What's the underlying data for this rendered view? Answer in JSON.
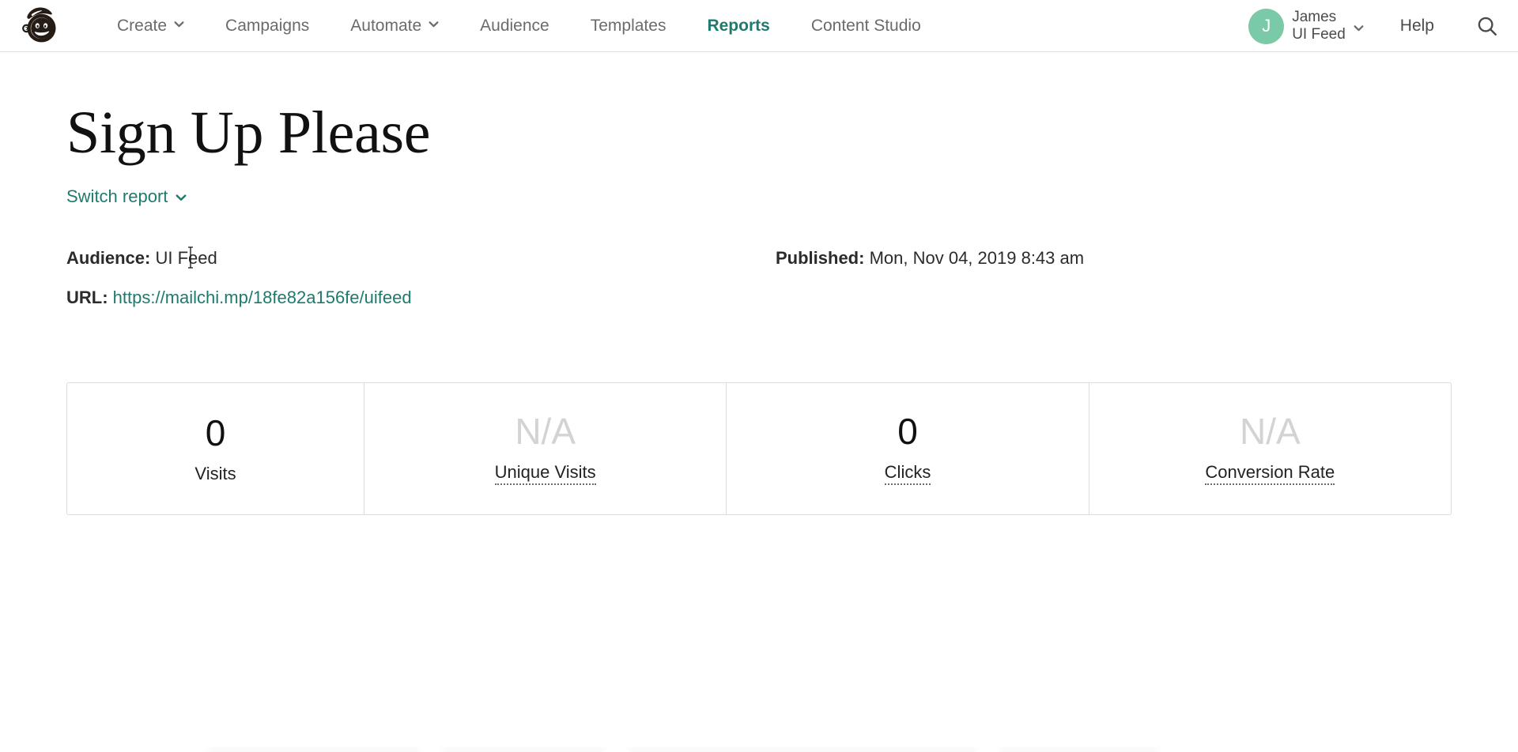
{
  "nav": {
    "logo": "mailchimp-freddie-logo",
    "items": [
      {
        "label": "Create",
        "has_caret": true,
        "active": false
      },
      {
        "label": "Campaigns",
        "has_caret": false,
        "active": false
      },
      {
        "label": "Automate",
        "has_caret": true,
        "active": false
      },
      {
        "label": "Audience",
        "has_caret": false,
        "active": false
      },
      {
        "label": "Templates",
        "has_caret": false,
        "active": false
      },
      {
        "label": "Reports",
        "has_caret": false,
        "active": true
      },
      {
        "label": "Content Studio",
        "has_caret": false,
        "active": false
      }
    ],
    "account": {
      "avatar_initial": "J",
      "avatar_color": "#7ac9a7",
      "user_name": "James",
      "account_name": "UI Feed"
    },
    "help_label": "Help",
    "search_icon": "search-icon",
    "active_color": "#1f7a6e"
  },
  "report": {
    "title": "Sign Up Please",
    "switch_report_label": "Switch report",
    "audience_label": "Audience:",
    "audience_value": "UI Feed",
    "url_label": "URL:",
    "url_value": "https://mailchi.mp/18fe82a156fe/uifeed",
    "published_label": "Published:",
    "published_value": "Mon, Nov 04, 2019 8:43 am",
    "link_color": "#1f7a6e"
  },
  "stats": [
    {
      "value": "0",
      "label": "Visits",
      "muted": false,
      "tooltip": false
    },
    {
      "value": "N/A",
      "label": "Unique Visits",
      "muted": true,
      "tooltip": true
    },
    {
      "value": "0",
      "label": "Clicks",
      "muted": false,
      "tooltip": true
    },
    {
      "value": "N/A",
      "label": "Conversion Rate",
      "muted": true,
      "tooltip": true
    }
  ]
}
